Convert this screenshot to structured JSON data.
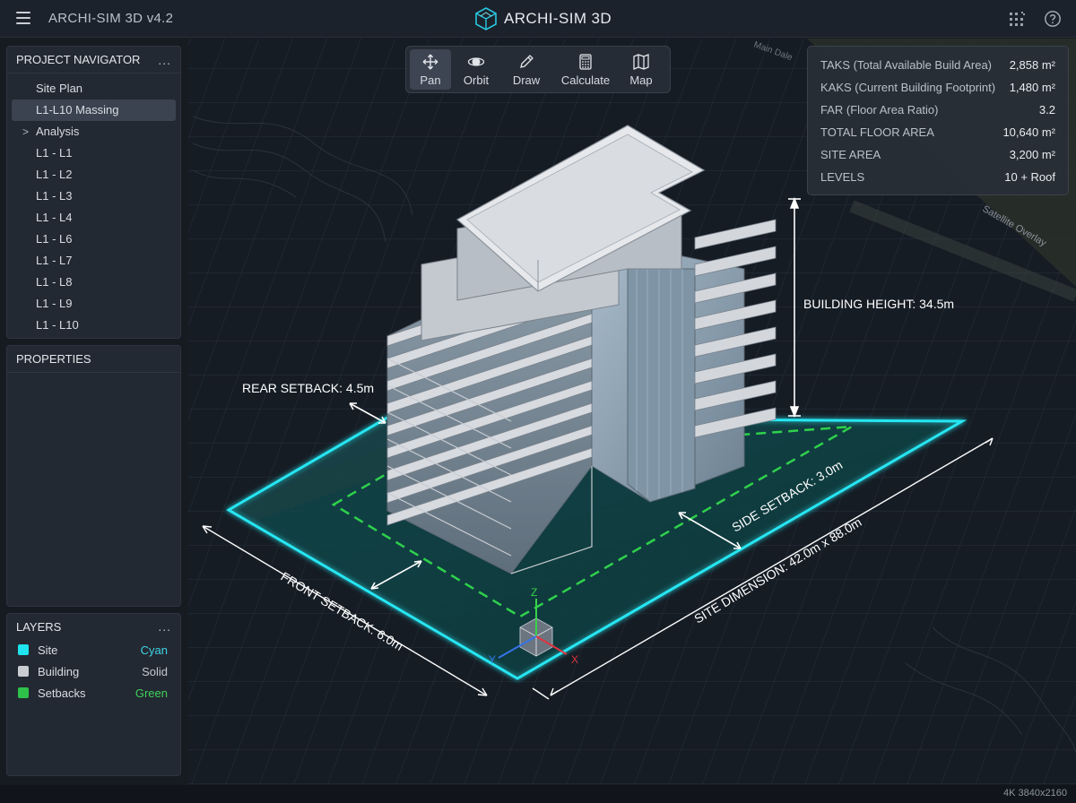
{
  "app": {
    "name": "ARCHI-SIM 3D v4.2",
    "brand": "ARCHI-SIM 3D",
    "resolution": "4K 3840x2160",
    "icons": {
      "menu": "hamburger-icon",
      "logo": "cube-logo-icon",
      "notifications": "qr-grid-icon",
      "help": "help-icon"
    }
  },
  "navigator": {
    "title": "PROJECT NAVIGATOR",
    "more": "...",
    "items": [
      {
        "label": "Site Plan",
        "selected": false,
        "expandable": false
      },
      {
        "label": "L1-L10 Massing",
        "selected": true,
        "expandable": false
      },
      {
        "label": "Analysis",
        "selected": false,
        "expandable": true
      },
      {
        "label": "L1 - L1",
        "selected": false,
        "expandable": false
      },
      {
        "label": "L1 - L2",
        "selected": false,
        "expandable": false
      },
      {
        "label": "L1 - L3",
        "selected": false,
        "expandable": false
      },
      {
        "label": "L1 - L4",
        "selected": false,
        "expandable": false
      },
      {
        "label": "L1 - L6",
        "selected": false,
        "expandable": false
      },
      {
        "label": "L1 - L7",
        "selected": false,
        "expandable": false
      },
      {
        "label": "L1 - L8",
        "selected": false,
        "expandable": false
      },
      {
        "label": "L1 - L9",
        "selected": false,
        "expandable": false
      },
      {
        "label": "L1 - L10",
        "selected": false,
        "expandable": false
      }
    ]
  },
  "properties": {
    "title": "PROPERTIES"
  },
  "layers": {
    "title": "LAYERS",
    "more": "...",
    "items": [
      {
        "name": "Site",
        "type": "Cyan",
        "color": "#1fe3ee",
        "type_color": "#3fd3e6"
      },
      {
        "name": "Building",
        "type": "Solid",
        "color": "#c9ccd1",
        "type_color": "#c4c9cf"
      },
      {
        "name": "Setbacks",
        "type": "Green",
        "color": "#2ec24a",
        "type_color": "#3fcf5b"
      }
    ]
  },
  "toolbar": {
    "tools": [
      {
        "label": "Pan",
        "icon": "pan-icon",
        "active": true
      },
      {
        "label": "Orbit",
        "icon": "orbit-icon",
        "active": false
      },
      {
        "label": "Draw",
        "icon": "pencil-icon",
        "active": false
      },
      {
        "label": "Calculate",
        "icon": "calculator-icon",
        "active": false
      },
      {
        "label": "Map",
        "icon": "map-icon",
        "active": false
      }
    ]
  },
  "stats": [
    {
      "label": "TAKS (Total Available Build Area)",
      "value": "2,858 m²"
    },
    {
      "label": "KAKS (Current Building Footprint)",
      "value": "1,480 m²"
    },
    {
      "label": "FAR (Floor Area Ratio)",
      "value": "3.2"
    },
    {
      "label": "TOTAL FLOOR AREA",
      "value": "10,640 m²"
    },
    {
      "label": "SITE AREA",
      "value": "3,200 m²"
    },
    {
      "label": "LEVELS",
      "value": "10 + Roof"
    }
  ],
  "annotations": {
    "rear_setback": "REAR SETBACK: 4.5m",
    "building_height": "BUILDING HEIGHT: 34.5m",
    "side_setback": "SIDE SETBACK: 3.0m",
    "site_dimension": "SITE DIMENSION: 42.0m x 88.0m",
    "front_setback": "FRONT SETBACK: 6.0m"
  },
  "gizmo": {
    "z": "Z",
    "x": "X",
    "y": "Y"
  },
  "map_labels": [
    "Satellite Overlay",
    "Main Dale"
  ]
}
